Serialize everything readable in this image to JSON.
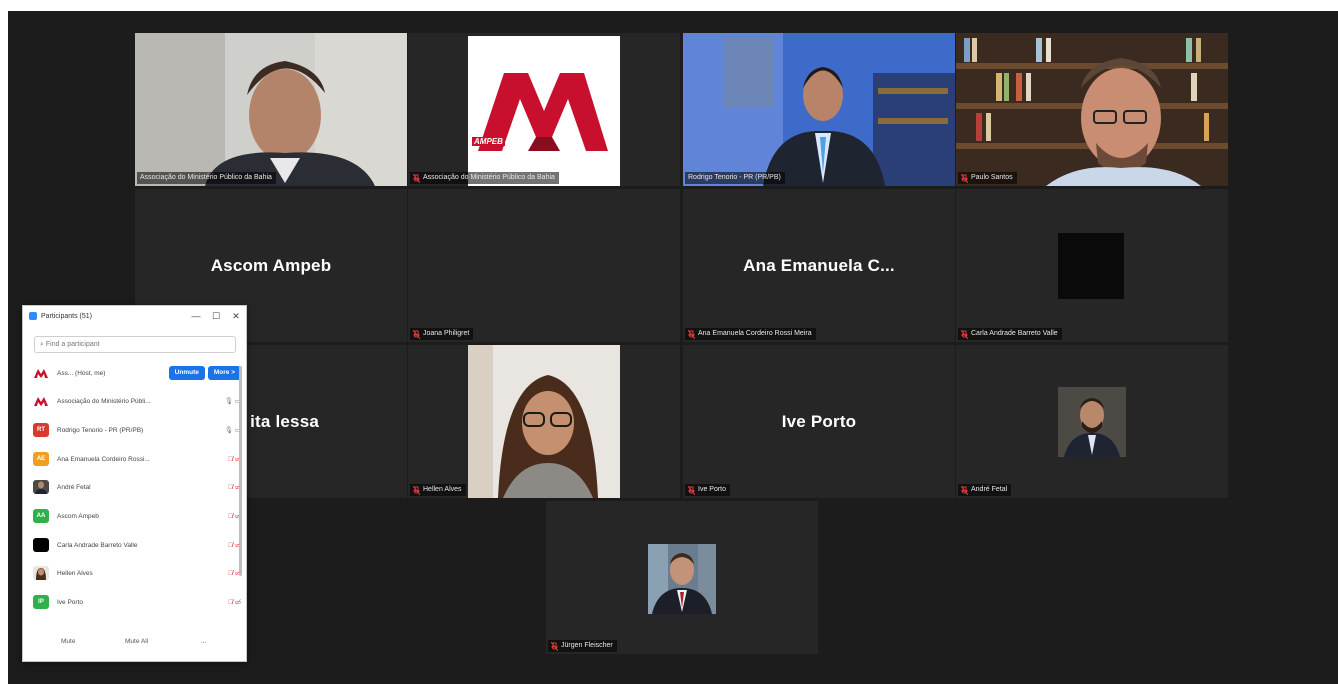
{
  "tiles": [
    {
      "id": "t1",
      "label": "Associação do Ministério Público da Bahia",
      "big": "",
      "muted": false
    },
    {
      "id": "t2",
      "label": "Associação do Ministério Público da Bahia",
      "big": "",
      "muted": true
    },
    {
      "id": "t3",
      "label": "Rodrigo Tenorio - PR (PR/PB)",
      "big": "",
      "muted": false
    },
    {
      "id": "t4",
      "label": "Paulo Santos",
      "big": "",
      "muted": true
    },
    {
      "id": "t5",
      "label": "",
      "big": "Ascom Ampeb",
      "muted": false
    },
    {
      "id": "t6",
      "label": "Joana Philigret",
      "big": "",
      "muted": true
    },
    {
      "id": "t7",
      "label": "Ana Emanuela Cordeiro Rossi Meira",
      "big": "Ana  Emanuela  C...",
      "muted": true
    },
    {
      "id": "t8",
      "label": "Carla Andrade Barreto Valle",
      "big": "",
      "muted": true
    },
    {
      "id": "t9",
      "label": "",
      "big": "ita lessa",
      "muted": false
    },
    {
      "id": "t10",
      "label": "Hellen Alves",
      "big": "",
      "muted": true
    },
    {
      "id": "t11",
      "label": "Ive Porto",
      "big": "Ive Porto",
      "muted": true
    },
    {
      "id": "t12",
      "label": "André Fetal",
      "big": "",
      "muted": true
    },
    {
      "id": "t13",
      "label": "Jürgen Fleischer",
      "big": "",
      "muted": true
    }
  ],
  "logo": {
    "text": "AMPEB",
    "color": "#c8102e"
  },
  "panel": {
    "title": "Participants (51)",
    "min": "—",
    "max": "☐",
    "close": "✕",
    "search_placeholder": "Find a participant",
    "unmute_label": "Unmute",
    "more_label": "More >",
    "rows": [
      {
        "name": "Ass... (Host, me)",
        "status": "",
        "avatar": "logo"
      },
      {
        "name": "Associação do Ministério Públi...",
        "status": "🎙 ▭",
        "avatar": "logo"
      },
      {
        "name": "Rodrigo Tenorio - PR (PR/PB)",
        "status": "🎙 ▭",
        "avatar": "RT"
      },
      {
        "name": "Ana Emanuela Cordeiro Rossi...",
        "status": "🎙̸ ▭̸",
        "avatar": "AE"
      },
      {
        "name": "André Fetal",
        "status": "🎙̸ ▭̸",
        "avatar": "photo"
      },
      {
        "name": "Ascom Ampeb",
        "status": "🎙̸ ▭̸",
        "avatar": "AA"
      },
      {
        "name": "Carla Andrade Barreto Valle",
        "status": "🎙̸ ▭̸",
        "avatar": "black"
      },
      {
        "name": "Hellen Alves",
        "status": "🎙̸ ▭̸",
        "avatar": "photo2"
      },
      {
        "name": "Ive Porto",
        "status": "🎙̸ ▭̸",
        "avatar": "IP"
      }
    ],
    "mute_label": "Mute",
    "mute_all_label": "Mute All",
    "more_footer_label": "..."
  },
  "colors": {
    "accent": "#1b73e8",
    "active_border": "#c9e04a",
    "muted_red": "#d02b2b"
  }
}
